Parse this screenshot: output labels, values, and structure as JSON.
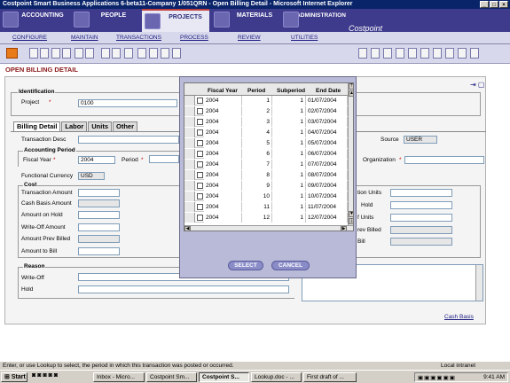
{
  "window": {
    "title": "Costpoint Smart Business Applications 6-beta11-Company 1/051QRN - Open Billing Detail - Microsoft Internet Explorer"
  },
  "main_nav": {
    "tabs": [
      "ACCOUNTING",
      "PEOPLE",
      "PROJECTS",
      "MATERIALS",
      "ADMINISTRATION"
    ],
    "brand": "Costpoint"
  },
  "sub_nav": [
    "CONFIGURE",
    "MAINTAIN",
    "TRANSACTIONS",
    "PROCESS",
    "REVIEW",
    "UTILITIES"
  ],
  "page": {
    "title": "OPEN BILLING DETAIL",
    "cash_basis_link": "Cash Basis"
  },
  "identification": {
    "label": "Identification",
    "project_label": "Project",
    "project_value": "0100"
  },
  "tabs": [
    "Billing Detail",
    "Labor",
    "Units",
    "Other"
  ],
  "billing": {
    "transaction_desc_label": "Transaction Desc",
    "source_label": "Source",
    "source_value": "USER",
    "accounting_period_label": "Accounting Period",
    "fiscal_year_label": "Fiscal Year",
    "fiscal_year_value": "2004",
    "period_label": "Period",
    "organization_label": "Organization",
    "functional_currency_label": "Functional Currency",
    "functional_currency_value": "USD"
  },
  "cost": {
    "label": "Cost",
    "fields": [
      "Transaction Amount",
      "Cash Basis Amount",
      "Amount on Hold",
      "Write-Off Amount",
      "Amount Prev Billed",
      "Amount to Bill"
    ]
  },
  "units": {
    "fields": [
      "tion Units",
      "Hold",
      "f Units",
      "rev Billed",
      "Bill"
    ]
  },
  "reason": {
    "label": "Reason",
    "fields": [
      "Write-Off",
      "Hold"
    ]
  },
  "lookup": {
    "columns": [
      "Fiscal Year",
      "Period",
      "Subperiod",
      "End Date"
    ],
    "rows": [
      [
        "2004",
        "1",
        "1",
        "01/07/2004"
      ],
      [
        "2004",
        "2",
        "1",
        "02/07/2004"
      ],
      [
        "2004",
        "3",
        "1",
        "03/07/2004"
      ],
      [
        "2004",
        "4",
        "1",
        "04/07/2004"
      ],
      [
        "2004",
        "5",
        "1",
        "05/07/2004"
      ],
      [
        "2004",
        "6",
        "1",
        "06/07/2004"
      ],
      [
        "2004",
        "7",
        "1",
        "07/07/2004"
      ],
      [
        "2004",
        "8",
        "1",
        "08/07/2004"
      ],
      [
        "2004",
        "9",
        "1",
        "09/07/2004"
      ],
      [
        "2004",
        "10",
        "1",
        "10/07/2004"
      ],
      [
        "2004",
        "11",
        "1",
        "11/07/2004"
      ],
      [
        "2004",
        "12",
        "1",
        "12/07/2004"
      ]
    ],
    "select_label": "SELECT",
    "cancel_label": "CANCEL"
  },
  "status_bar": {
    "message": "Enter, or use Lookup to select, the period in which this transaction was posted or occurred.",
    "zone": "Local intranet"
  },
  "taskbar": {
    "start_label": "Start",
    "tasks": [
      "Inbox - Micro...",
      "Costpoint Sm...",
      "Costpoint S...",
      "Lookup.doc - ...",
      "First draft of ..."
    ],
    "clock": "9:41 AM"
  }
}
